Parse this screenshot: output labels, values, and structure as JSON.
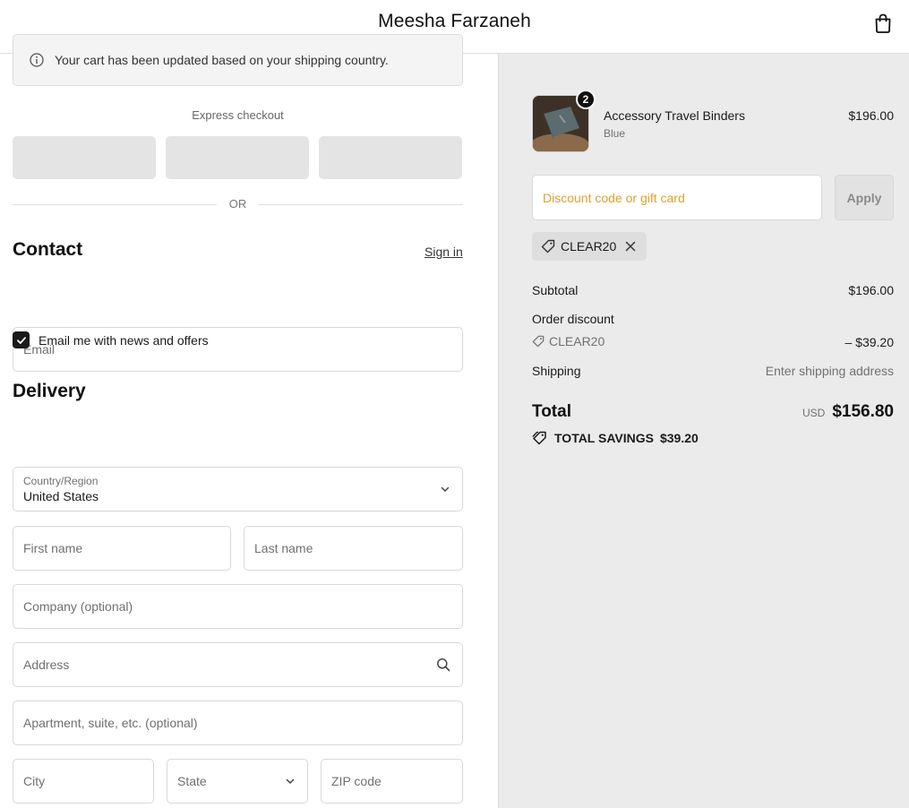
{
  "header": {
    "store_name": "Meesha Farzaneh",
    "bag_icon": "shopping-bag-icon"
  },
  "notice": {
    "text": "Your cart has been updated based on your shipping country.",
    "icon": "info-icon"
  },
  "express": {
    "label": "Express checkout",
    "divider": "OR"
  },
  "contact": {
    "title": "Contact",
    "sign_in": "Sign in",
    "email_placeholder": "Email",
    "newsletter_label": "Email me with news and offers",
    "newsletter_checked": true
  },
  "delivery": {
    "title": "Delivery",
    "country_label": "Country/Region",
    "country_value": "United States",
    "first_name": "First name",
    "last_name": "Last name",
    "company": "Company (optional)",
    "address": "Address",
    "apartment": "Apartment, suite, etc. (optional)",
    "city": "City",
    "state": "State",
    "zip": "ZIP code"
  },
  "summary": {
    "product": {
      "name": "Accessory Travel Binders",
      "variant": "Blue",
      "price": "$196.00",
      "quantity": "2"
    },
    "discount_placeholder": "Discount code or gift card",
    "apply": "Apply",
    "applied_code": "CLEAR20",
    "subtotal_label": "Subtotal",
    "subtotal_value": "$196.00",
    "order_discount_label": "Order discount",
    "discount_code": "CLEAR20",
    "discount_value": "– $39.20",
    "shipping_label": "Shipping",
    "shipping_value": "Enter shipping address",
    "total_label": "Total",
    "currency": "USD",
    "total_value": "$156.80",
    "savings_label": "TOTAL SAVINGS",
    "savings_value": "$39.20"
  },
  "colors": {
    "accent": "#1a1a1a",
    "panel": "#ebebeb",
    "placeholder_highlight": "#e0a030"
  }
}
